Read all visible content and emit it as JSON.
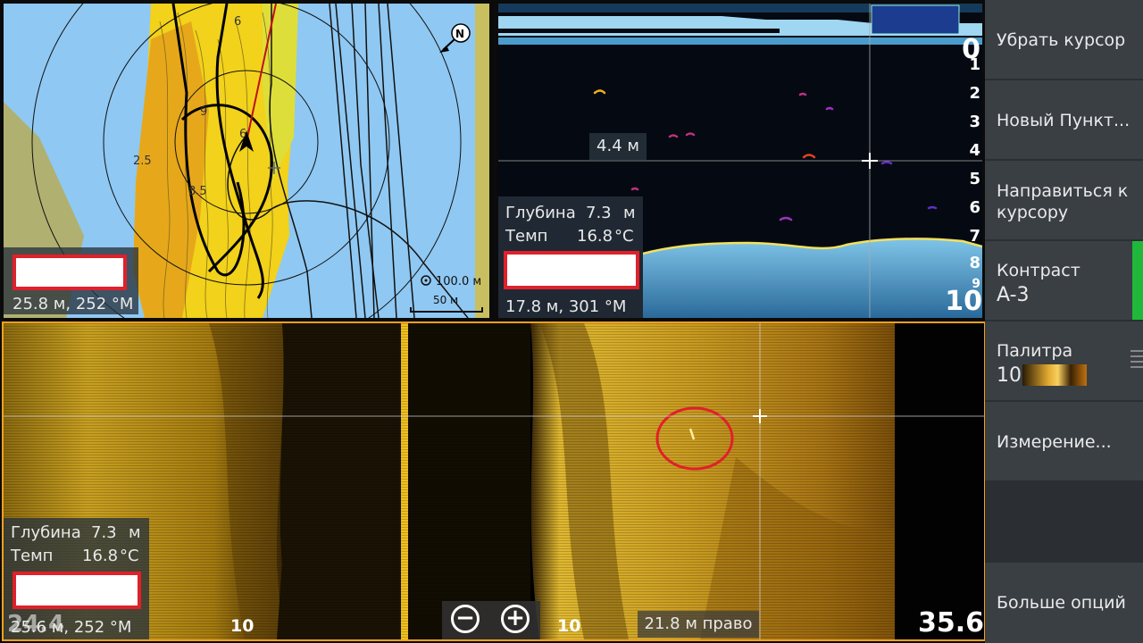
{
  "chart_panel": {
    "position": "25.8 м, 252 °M",
    "range_label": "100.0 м",
    "scale_label": "50 м",
    "north": "N",
    "contour_labels": [
      "6",
      "9",
      "6",
      "8.5",
      "2.5"
    ]
  },
  "sonar_panel": {
    "depth_label": "Глубина",
    "depth_value": "7.3",
    "depth_unit": "м",
    "temp_label": "Темп",
    "temp_value": "16.8",
    "temp_unit": "°C",
    "position": "17.8 м, 301 °M",
    "cursor_depth": "4.4 м",
    "range_top": "0",
    "range_bottom": "10",
    "scale": [
      "1",
      "2",
      "3",
      "4",
      "5",
      "6",
      "7",
      "8",
      "9"
    ]
  },
  "sidescan_panel": {
    "depth_label": "Глубина",
    "depth_value": "7.3",
    "depth_unit": "м",
    "temp_label": "Темп",
    "temp_value": "16.8",
    "temp_unit": "°C",
    "position": "25.6 м, 252 °M",
    "range_left": "24.4",
    "range_right": "35.6",
    "marker_left": "10",
    "marker_right": "10",
    "cursor_distance": "21.8 м право",
    "zoom_out": "−",
    "zoom_in": "+"
  },
  "menu": {
    "remove_cursor": "Убрать курсор",
    "new_waypoint": "Новый Пункт...",
    "goto_cursor": "Направиться к курсору",
    "contrast_label": "Контраст",
    "contrast_value": "A-3",
    "palette_label": "Палитра",
    "palette_value": "10",
    "measure": "Измерение...",
    "more_options": "Больше опций"
  },
  "colors": {
    "accent": "#f5a020",
    "contrast_bar": "#1fb83a",
    "redact": "#e0202a"
  }
}
